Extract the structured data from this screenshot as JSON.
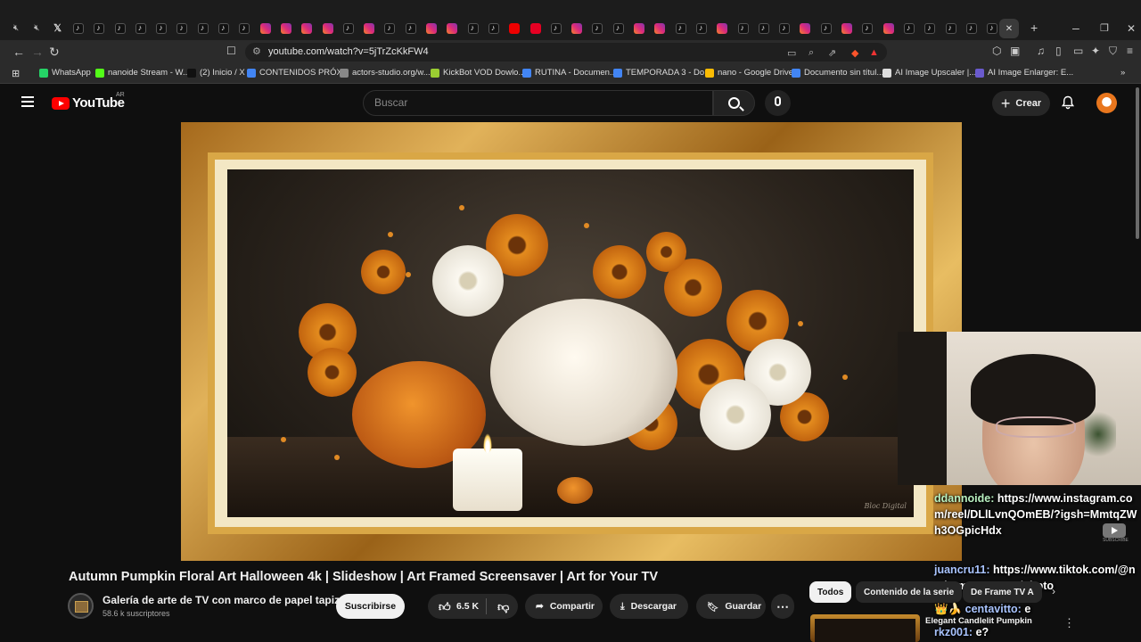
{
  "browser": {
    "url": "youtube.com/watch?v=5jTrZcKkFW4",
    "tab_icons": [
      "mute-icon",
      "mute-icon",
      "x-icon",
      "tiktok-icon",
      "tiktok-icon",
      "tiktok-icon",
      "tiktok-icon",
      "tiktok-icon",
      "tiktok-icon",
      "tiktok-icon",
      "tiktok-icon",
      "tiktok-icon",
      "instagram-icon",
      "instagram-icon",
      "instagram-icon",
      "instagram-icon",
      "tiktok-icon",
      "instagram-icon",
      "tiktok-icon",
      "tiktok-icon",
      "instagram-icon",
      "instagram-icon",
      "tiktok-icon",
      "tiktok-icon",
      "youtube-icon",
      "pinterest-icon",
      "tiktok-icon",
      "instagram-icon",
      "tiktok-icon",
      "tiktok-icon",
      "instagram-icon",
      "instagram-icon",
      "tiktok-icon",
      "tiktok-icon",
      "instagram-icon",
      "tiktok-icon",
      "tiktok-icon",
      "tiktok-icon",
      "instagram-icon",
      "tiktok-icon",
      "instagram-icon",
      "tiktok-icon",
      "instagram-icon",
      "tiktok-icon",
      "tiktok-icon",
      "tiktok-icon",
      "tiktok-icon",
      "tiktok-icon"
    ],
    "new_tab_label": "+",
    "win_minimize": "–",
    "win_maximize": "❐",
    "win_close": "✕",
    "bookmarks": [
      {
        "label": "WhatsApp",
        "color": "#25d366"
      },
      {
        "label": "nanoide Stream - W...",
        "color": "#53fc18"
      },
      {
        "label": "(2) Inicio / X",
        "color": "#111111"
      },
      {
        "label": "CONTENIDOS PRÓX...",
        "color": "#4285f4"
      },
      {
        "label": "actors-studio.org/w...",
        "color": "#888888"
      },
      {
        "label": "KickBot VOD Dowlo...",
        "color": "#9acd32"
      },
      {
        "label": "RUTINA - Documen...",
        "color": "#4285f4"
      },
      {
        "label": "TEMPORADA 3 - Do...",
        "color": "#4285f4"
      },
      {
        "label": "nano - Google Drive",
        "color": "#fbbc04"
      },
      {
        "label": "Documento sin títul...",
        "color": "#4285f4"
      },
      {
        "label": "AI Image Upscaler |...",
        "color": "#dddddd"
      },
      {
        "label": "AI Image Enlarger: E...",
        "color": "#6a5acd"
      }
    ]
  },
  "yt": {
    "logo_text": "YouTube",
    "country": "AR",
    "search_placeholder": "Buscar",
    "create_label": "Crear"
  },
  "video": {
    "title": "Autumn Pumpkin Floral Art Halloween 4k | Slideshow | Art Framed Screensaver | Art for Your TV",
    "signature": "Bloc Digital",
    "channel_name": "Galería de arte de TV con marco de papel tapiz",
    "subscribers": "58.6 k suscriptores",
    "subscribe_label": "Suscribirse",
    "likes": "6.5 K",
    "share_label": "Compartir",
    "download_label": "Descargar",
    "save_label": "Guardar",
    "more_label": "⋯"
  },
  "chips": [
    "Todos",
    "Contenido de la serie",
    "De Frame TV A"
  ],
  "recommendation": {
    "title": "Elegant Candlelit Pumpkin"
  },
  "chat": [
    {
      "user": "ddannoide:",
      "message": "https://www.instagram.com/reel/DLlLvnQOmEB/?igsh=MmtqZWh3OGpicHdx"
    },
    {
      "user": "juancru11:",
      "message": "https://www.tiktok.com/@no.humor.memes/photo"
    },
    {
      "user": "centavitto:",
      "message": "e",
      "prefix": "👑🍌"
    },
    {
      "user": "rkz001:",
      "message": "e?"
    }
  ],
  "sub_badge_text": "SUBSCRIBE"
}
